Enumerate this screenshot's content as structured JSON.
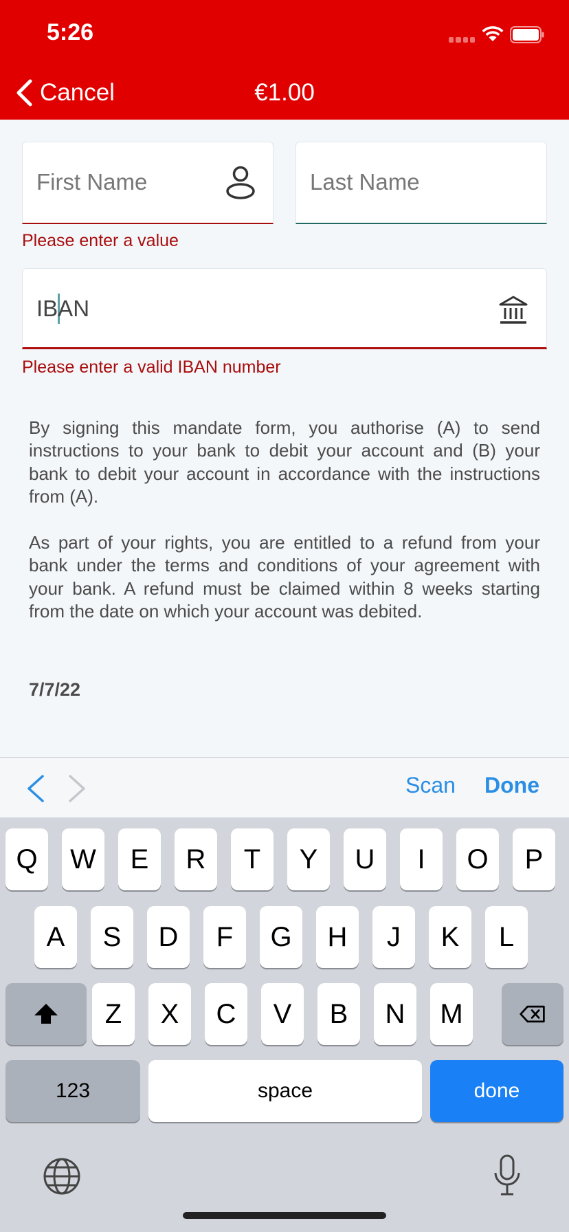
{
  "status_bar": {
    "time": "5:26"
  },
  "nav": {
    "cancel_label": "Cancel",
    "amount": "€1.00"
  },
  "form": {
    "first_name": {
      "placeholder": "First Name",
      "error": "Please enter a value"
    },
    "last_name": {
      "placeholder": "Last Name"
    },
    "iban": {
      "placeholder": "IBAN",
      "error": "Please enter a valid IBAN number"
    }
  },
  "mandate": {
    "paragraph_1": "By signing this mandate form, you authorise (A) to send instructions to your bank to debit your account and (B) your bank to debit your account in accordance with the instructions from (A).",
    "paragraph_2": "As part of your rights, you are entitled to a refund from your bank under the terms and conditions of your agreement with your bank. A refund must be claimed within 8 weeks starting from the date on which your account was debited.",
    "date": "7/7/22"
  },
  "accessory_bar": {
    "scan_label": "Scan",
    "done_label": "Done"
  },
  "keyboard": {
    "row1": [
      "Q",
      "W",
      "E",
      "R",
      "T",
      "Y",
      "U",
      "I",
      "O",
      "P"
    ],
    "row2": [
      "A",
      "S",
      "D",
      "F",
      "G",
      "H",
      "J",
      "K",
      "L"
    ],
    "row3": [
      "Z",
      "X",
      "C",
      "V",
      "B",
      "N",
      "M"
    ],
    "numbers_label": "123",
    "space_label": "space",
    "return_label": "done"
  },
  "colors": {
    "header": "#e10000",
    "error": "#a80d0d",
    "accent": "#2b8ee5",
    "return_key": "#1a80f5"
  },
  "icons": [
    "chevron-left-icon",
    "person-icon",
    "bank-icon",
    "chevron-right-icon",
    "shift-icon",
    "delete-icon",
    "globe-icon",
    "microphone-icon",
    "wifi-icon",
    "battery-icon",
    "signal-icon"
  ]
}
